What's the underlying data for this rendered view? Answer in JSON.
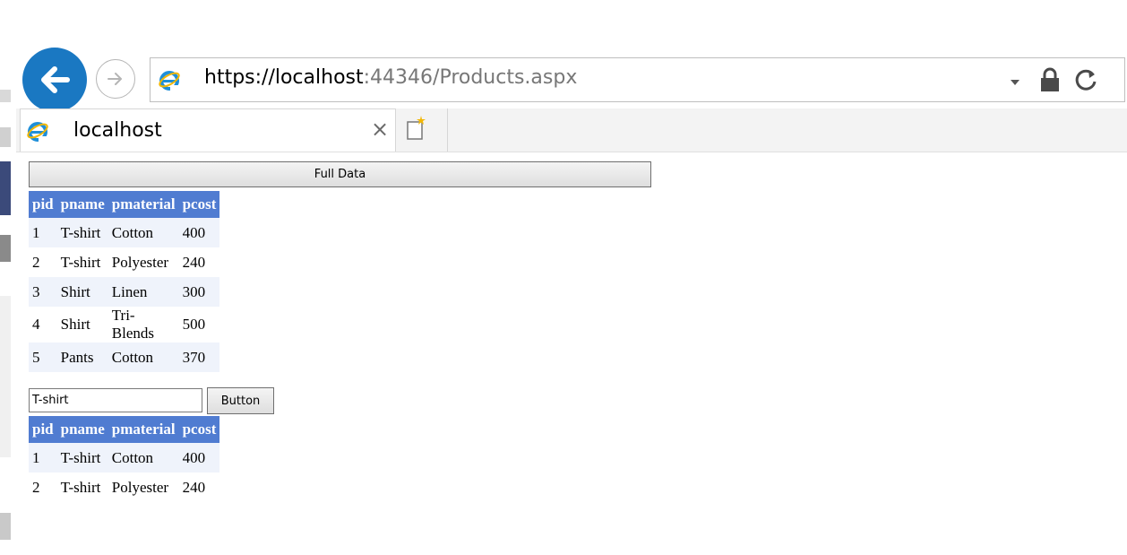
{
  "browser": {
    "url_scheme_host": "https://localhost",
    "url_port_path_a": ":44346",
    "url_path": "/Products.aspx",
    "tab_title": "localhost",
    "tab_close": "×"
  },
  "page": {
    "full_data_button": "Full Data",
    "search_value": "T-shirt",
    "search_button": "Button",
    "columns": [
      "pid",
      "pname",
      "pmaterial",
      "pcost"
    ],
    "full_rows": [
      [
        "1",
        "T-shirt",
        "Cotton",
        "400"
      ],
      [
        "2",
        "T-shirt",
        "Polyester",
        "240"
      ],
      [
        "3",
        "Shirt",
        "Linen",
        "300"
      ],
      [
        "4",
        "Shirt",
        "Tri-Blends",
        "500"
      ],
      [
        "5",
        "Pants",
        "Cotton",
        "370"
      ]
    ],
    "filtered_rows": [
      [
        "1",
        "T-shirt",
        "Cotton",
        "400"
      ],
      [
        "2",
        "T-shirt",
        "Polyester",
        "240"
      ]
    ]
  },
  "colors": {
    "header_bg": "#507cd1",
    "alt_row_bg": "#eff3fb",
    "back_button": "#1a78c2"
  },
  "icons": {
    "back": "arrow-left-icon",
    "forward": "arrow-right-icon",
    "site": "internet-explorer-icon",
    "lock": "lock-icon",
    "refresh": "refresh-icon",
    "dropdown": "chevron-down-icon",
    "new_tab": "new-tab-icon"
  }
}
